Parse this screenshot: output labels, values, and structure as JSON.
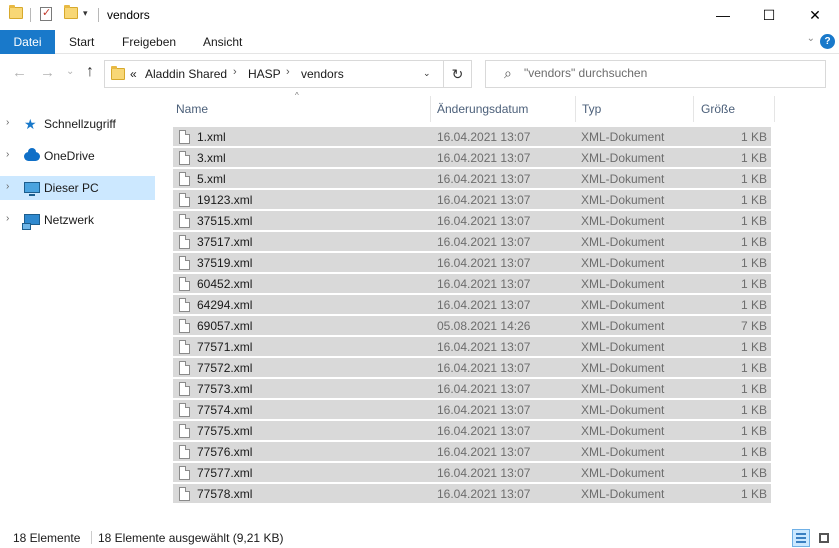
{
  "window": {
    "title": "vendors",
    "minimize_glyph": "—",
    "maximize_glyph": "☐",
    "close_glyph": "✕",
    "quick_access_arrow": "▾"
  },
  "ribbon": {
    "tabs": [
      {
        "label": "Datei"
      },
      {
        "label": "Start"
      },
      {
        "label": "Freigeben"
      },
      {
        "label": "Ansicht"
      }
    ],
    "expand_glyph": "⌄",
    "help_glyph": "?"
  },
  "nav": {
    "back_glyph": "←",
    "forward_glyph": "→",
    "recent_glyph": "⌄",
    "up_glyph": "↑",
    "overflow_glyph": "«",
    "breadcrumbs": [
      "Aladdin Shared",
      "HASP",
      "vendors"
    ],
    "crumb_separator": "›",
    "dropdown_glyph": "⌄",
    "refresh_glyph": "↻"
  },
  "search": {
    "icon_glyph": "⌕",
    "placeholder": "\"vendors\" durchsuchen"
  },
  "sidebar": {
    "chevron_glyph": "›",
    "items": [
      {
        "label": "Schnellzugriff",
        "icon": "star-icon"
      },
      {
        "label": "OneDrive",
        "icon": "cloud-icon"
      },
      {
        "label": "Dieser PC",
        "icon": "computer-icon",
        "selected": true
      },
      {
        "label": "Netzwerk",
        "icon": "network-icon"
      }
    ]
  },
  "file_list": {
    "columns": {
      "name": "Name",
      "date": "Änderungsdatum",
      "type": "Typ",
      "size": "Größe"
    },
    "sort_glyph": "^",
    "rows": [
      {
        "name": "1.xml",
        "date": "16.04.2021 13:07",
        "type": "XML-Dokument",
        "size": "1 KB"
      },
      {
        "name": "3.xml",
        "date": "16.04.2021 13:07",
        "type": "XML-Dokument",
        "size": "1 KB"
      },
      {
        "name": "5.xml",
        "date": "16.04.2021 13:07",
        "type": "XML-Dokument",
        "size": "1 KB"
      },
      {
        "name": "19123.xml",
        "date": "16.04.2021 13:07",
        "type": "XML-Dokument",
        "size": "1 KB"
      },
      {
        "name": "37515.xml",
        "date": "16.04.2021 13:07",
        "type": "XML-Dokument",
        "size": "1 KB"
      },
      {
        "name": "37517.xml",
        "date": "16.04.2021 13:07",
        "type": "XML-Dokument",
        "size": "1 KB"
      },
      {
        "name": "37519.xml",
        "date": "16.04.2021 13:07",
        "type": "XML-Dokument",
        "size": "1 KB"
      },
      {
        "name": "60452.xml",
        "date": "16.04.2021 13:07",
        "type": "XML-Dokument",
        "size": "1 KB"
      },
      {
        "name": "64294.xml",
        "date": "16.04.2021 13:07",
        "type": "XML-Dokument",
        "size": "1 KB"
      },
      {
        "name": "69057.xml",
        "date": "05.08.2021 14:26",
        "type": "XML-Dokument",
        "size": "7 KB"
      },
      {
        "name": "77571.xml",
        "date": "16.04.2021 13:07",
        "type": "XML-Dokument",
        "size": "1 KB"
      },
      {
        "name": "77572.xml",
        "date": "16.04.2021 13:07",
        "type": "XML-Dokument",
        "size": "1 KB"
      },
      {
        "name": "77573.xml",
        "date": "16.04.2021 13:07",
        "type": "XML-Dokument",
        "size": "1 KB"
      },
      {
        "name": "77574.xml",
        "date": "16.04.2021 13:07",
        "type": "XML-Dokument",
        "size": "1 KB"
      },
      {
        "name": "77575.xml",
        "date": "16.04.2021 13:07",
        "type": "XML-Dokument",
        "size": "1 KB"
      },
      {
        "name": "77576.xml",
        "date": "16.04.2021 13:07",
        "type": "XML-Dokument",
        "size": "1 KB"
      },
      {
        "name": "77577.xml",
        "date": "16.04.2021 13:07",
        "type": "XML-Dokument",
        "size": "1 KB"
      },
      {
        "name": "77578.xml",
        "date": "16.04.2021 13:07",
        "type": "XML-Dokument",
        "size": "1 KB"
      }
    ]
  },
  "status": {
    "item_count": "18 Elemente",
    "selection": "18 Elemente ausgewählt (9,21 KB)"
  },
  "colors": {
    "accent": "#1979ca",
    "selection_row": "#d9d9d9",
    "sidebar_selected": "#cce8ff",
    "header_text": "#4c607a"
  }
}
